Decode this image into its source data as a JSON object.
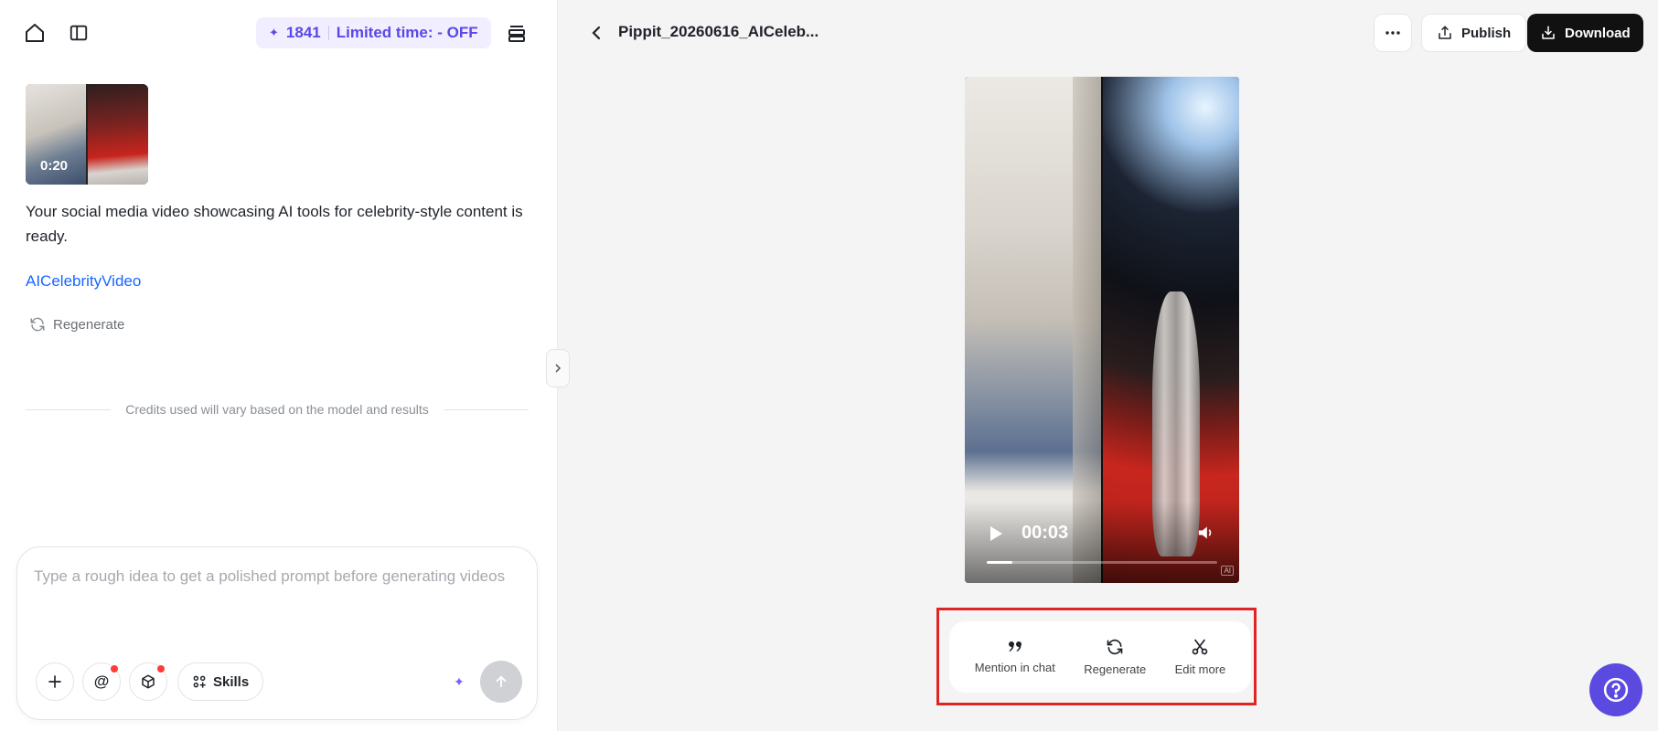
{
  "left_panel": {
    "credits": {
      "count": "1841",
      "promo": "Limited time: - OFF"
    },
    "result": {
      "thumbnail_duration": "0:20",
      "message": "Your social media video showcasing AI tools for celebrity-style content is ready.",
      "tag_link": "AICelebrityVideo",
      "regenerate_label": "Regenerate"
    },
    "credits_notice": "Credits used will vary based on the model and results",
    "composer": {
      "placeholder": "Type a rough idea to get a polished prompt before generating videos",
      "value": "",
      "skills_label": "Skills"
    }
  },
  "right_panel": {
    "title": "Pippit_20260616_AICeleb...",
    "publish_label": "Publish",
    "download_label": "Download",
    "player": {
      "current_time": "00:03",
      "progress": 0.11,
      "ai_badge": "AI"
    },
    "actions": [
      {
        "label": "Mention in chat"
      },
      {
        "label": "Regenerate"
      },
      {
        "label": "Edit more"
      }
    ]
  },
  "colors": {
    "accent": "#5b47e6",
    "link": "#1a66ff",
    "highlight_frame": "#e02424",
    "help_button": "#5b4ae0"
  },
  "icons": [
    "home-icon",
    "sidebar-toggle-icon",
    "history-icon",
    "refresh-icon",
    "plus-icon",
    "at-icon",
    "cube-icon",
    "skills-grid-icon",
    "sparkle-icon",
    "arrow-up-icon",
    "chevron-left-icon",
    "more-dots-icon",
    "upload-icon",
    "download-icon",
    "play-icon",
    "volume-icon",
    "quote-icon",
    "scissors-icon",
    "help-icon"
  ]
}
